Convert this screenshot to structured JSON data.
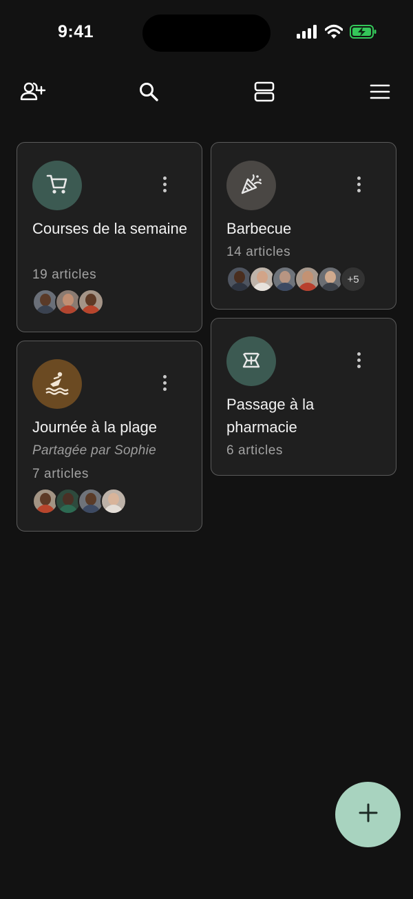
{
  "status_bar": {
    "time": "9:41",
    "icons": [
      "cellular-signal-icon",
      "wifi-icon",
      "battery-charging-icon"
    ],
    "battery_color": "#34c759"
  },
  "toolbar": {
    "icons": [
      "add-person-icon",
      "search-icon",
      "view-agenda-icon",
      "menu-icon"
    ]
  },
  "colors": {
    "background": "#121212",
    "card_background": "#1f1f1f",
    "card_border": "#5b5b5b",
    "fab": "#a8d3bf"
  },
  "cards": [
    {
      "title": "Courses de la semaine",
      "count": "19 articles",
      "icon": "shopping-cart-icon",
      "icon_bg": "#3c5a52",
      "avatars": 3
    },
    {
      "title": "Barbecue",
      "count": "14 articles",
      "icon": "party-popper-icon",
      "icon_bg": "#4a4744",
      "avatars": 5,
      "more": "+5"
    },
    {
      "title": "Journée à la plage",
      "shared_by": "Partagée par Sophie",
      "count": "7 articles",
      "icon": "surfing-icon",
      "icon_bg": "#6b4a22",
      "avatars": 4
    },
    {
      "title": "Passage à la pharmacie",
      "count": "6 articles",
      "icon": "medication-icon",
      "icon_bg": "#3c5a52"
    }
  ],
  "fab": {
    "icon": "plus-icon"
  }
}
